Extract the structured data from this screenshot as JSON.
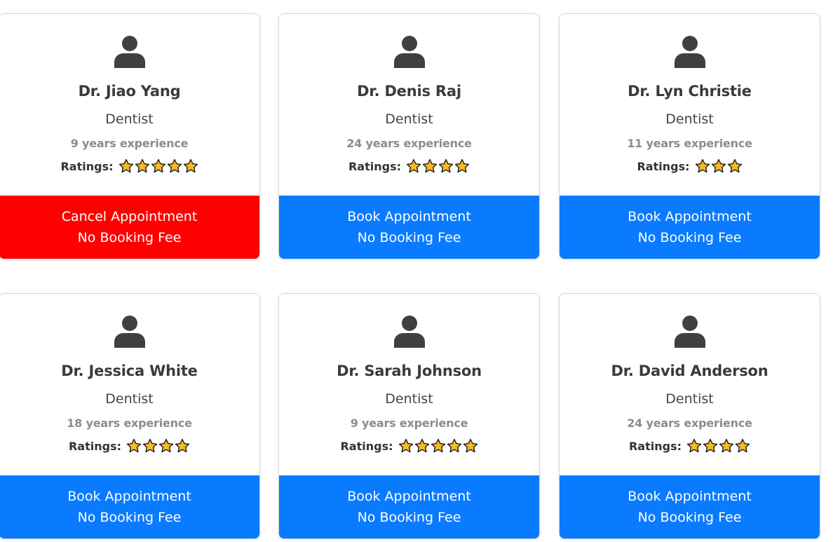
{
  "colors": {
    "book": "#0a7bff",
    "cancel": "#ff0000",
    "star_fill": "#f9b824",
    "icon": "#404040"
  },
  "ratings_label": "Ratings:",
  "doctors": [
    {
      "name": "Dr. Jiao Yang",
      "speciality": "Dentist",
      "experience": "9 years experience",
      "stars": 5,
      "action": "Cancel Appointment",
      "fee": "No Booking Fee",
      "action_type": "cancel"
    },
    {
      "name": "Dr. Denis Raj",
      "speciality": "Dentist",
      "experience": "24 years experience",
      "stars": 4,
      "action": "Book Appointment",
      "fee": "No Booking Fee",
      "action_type": "book"
    },
    {
      "name": "Dr. Lyn Christie",
      "speciality": "Dentist",
      "experience": "11 years experience",
      "stars": 3,
      "action": "Book Appointment",
      "fee": "No Booking Fee",
      "action_type": "book"
    },
    {
      "name": "Dr. Jessica White",
      "speciality": "Dentist",
      "experience": "18 years experience",
      "stars": 4,
      "action": "Book Appointment",
      "fee": "No Booking Fee",
      "action_type": "book"
    },
    {
      "name": "Dr. Sarah Johnson",
      "speciality": "Dentist",
      "experience": "9 years experience",
      "stars": 5,
      "action": "Book Appointment",
      "fee": "No Booking Fee",
      "action_type": "book"
    },
    {
      "name": "Dr. David Anderson",
      "speciality": "Dentist",
      "experience": "24 years experience",
      "stars": 4,
      "action": "Book Appointment",
      "fee": "No Booking Fee",
      "action_type": "book"
    }
  ]
}
